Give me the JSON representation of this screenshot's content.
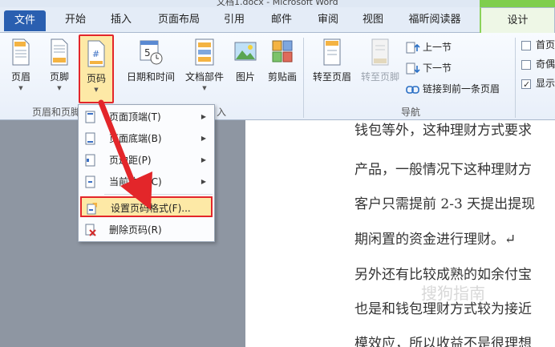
{
  "window": {
    "title": "文档1.docx - Microsoft Word"
  },
  "tabs": [
    {
      "label": "文件"
    },
    {
      "label": "开始"
    },
    {
      "label": "插入"
    },
    {
      "label": "页面布局"
    },
    {
      "label": "引用"
    },
    {
      "label": "邮件"
    },
    {
      "label": "审阅"
    },
    {
      "label": "视图"
    },
    {
      "label": "福昕阅读器"
    },
    {
      "label": "设计"
    }
  ],
  "ribbon": {
    "header": "页眉",
    "footer": "页脚",
    "page_number": "页码",
    "datetime": "日期和时间",
    "doc_parts": "文档部件",
    "picture": "图片",
    "clipart": "剪贴画",
    "goto_header": "转至页眉",
    "goto_footer": "转至页脚",
    "prev_section": "上一节",
    "next_section": "下一节",
    "link_prev": "链接到前一条页眉",
    "group_header_footer": "页眉和页脚",
    "group_insert_tail": "入",
    "group_nav": "导航",
    "options": [
      {
        "label": "首页",
        "checked": false
      },
      {
        "label": "奇偶",
        "checked": false
      },
      {
        "label": "显示",
        "checked": true
      }
    ]
  },
  "menu": {
    "items": [
      {
        "label": "页面顶端(T)",
        "submenu": true
      },
      {
        "label": "页面底端(B)",
        "submenu": true
      },
      {
        "label": "页边距(P)",
        "submenu": true
      },
      {
        "label": "当前位置(C)",
        "submenu": true
      },
      {
        "label": "设置页码格式(F)...",
        "submenu": false
      },
      {
        "label": "删除页码(R)",
        "submenu": false
      }
    ]
  },
  "document": {
    "lines": [
      "钱包等外，这种理财方式要求",
      "产品，一般情况下这种理财方",
      "客户只需提前 2-3 天提出提现",
      "期闲置的资金进行理财。↵",
      "另外还有比较成熟的如余付宝",
      "也是和钱包理财方式较为接近",
      "模效应，所以收益不是很理想"
    ]
  },
  "watermark": "搜狗指南",
  "colors": {
    "highlight": "#fde9a6",
    "annotation_red": "#e3262a",
    "file_tab": "#2a5fb0",
    "design_tab": "#7fce4e"
  }
}
